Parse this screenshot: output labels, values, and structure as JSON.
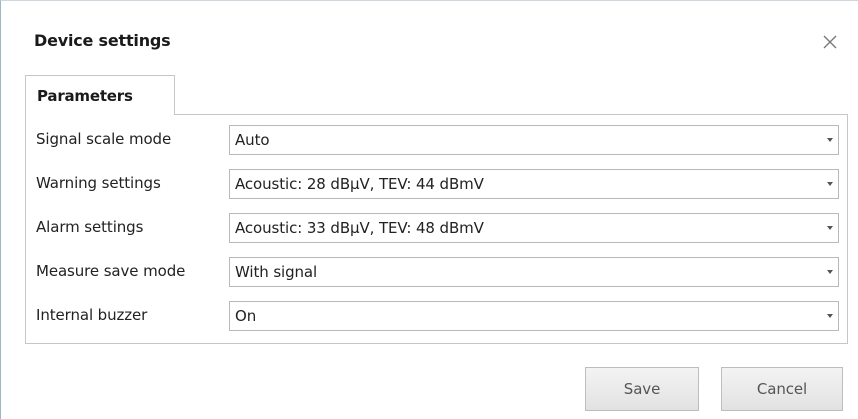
{
  "dialog": {
    "title": "Device settings",
    "close_icon": "close-icon"
  },
  "tabs": [
    {
      "label": "Parameters",
      "active": true
    }
  ],
  "settings": [
    {
      "label": "Signal scale mode",
      "value": "Auto"
    },
    {
      "label": "Warning settings",
      "value": "Acoustic: 28 dBµV, TEV: 44 dBmV"
    },
    {
      "label": "Alarm settings",
      "value": "Acoustic: 33 dBµV, TEV: 48 dBmV"
    },
    {
      "label": "Measure save mode",
      "value": "With signal"
    },
    {
      "label": "Internal buzzer",
      "value": "On"
    }
  ],
  "buttons": {
    "save_label": "Save",
    "cancel_label": "Cancel"
  },
  "icons": {
    "dropdown": "chevron-down-icon"
  }
}
